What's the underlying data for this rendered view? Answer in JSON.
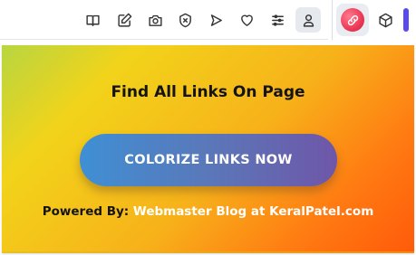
{
  "toolbar": {
    "icons": [
      {
        "name": "reading-mode-icon"
      },
      {
        "name": "edit-icon"
      },
      {
        "name": "camera-icon"
      },
      {
        "name": "shield-x-icon"
      },
      {
        "name": "send-icon"
      },
      {
        "name": "heart-icon"
      },
      {
        "name": "sliders-icon"
      },
      {
        "name": "profile-icon"
      },
      {
        "name": "link-colorizer-extension-icon"
      },
      {
        "name": "cube-icon"
      }
    ],
    "colors": {
      "extension": "#ef3e5a",
      "accent": "#5a4bf0"
    }
  },
  "popup": {
    "title": "Find All Links On Page",
    "cta_label": "COLORIZE LINKS NOW",
    "powered_label": "Powered By:",
    "powered_link": "Webmaster Blog at KeralPatel.com",
    "colors": {
      "gradient_start": "#f2d31a",
      "gradient_end": "#ff5a0a",
      "button_start": "#3f8fd4",
      "button_end": "#6f56a8"
    }
  }
}
